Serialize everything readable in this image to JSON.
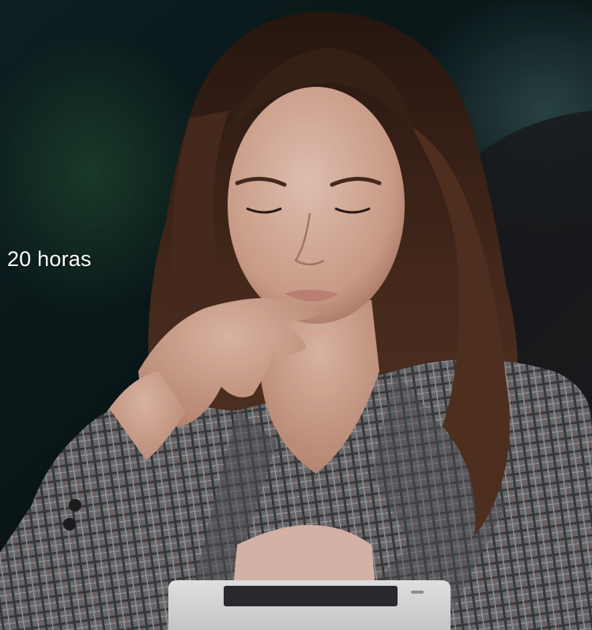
{
  "hero": {
    "caption": "20 horas",
    "photo_icon": "woman-reading-tablet-photo"
  },
  "colors": {
    "background": "#0e2224",
    "caption_text": "#ffffff",
    "jacket": "#6d6f72",
    "hair": "#3a2318",
    "skin": "#e2b49f",
    "tablet": "#e9e9e9"
  }
}
